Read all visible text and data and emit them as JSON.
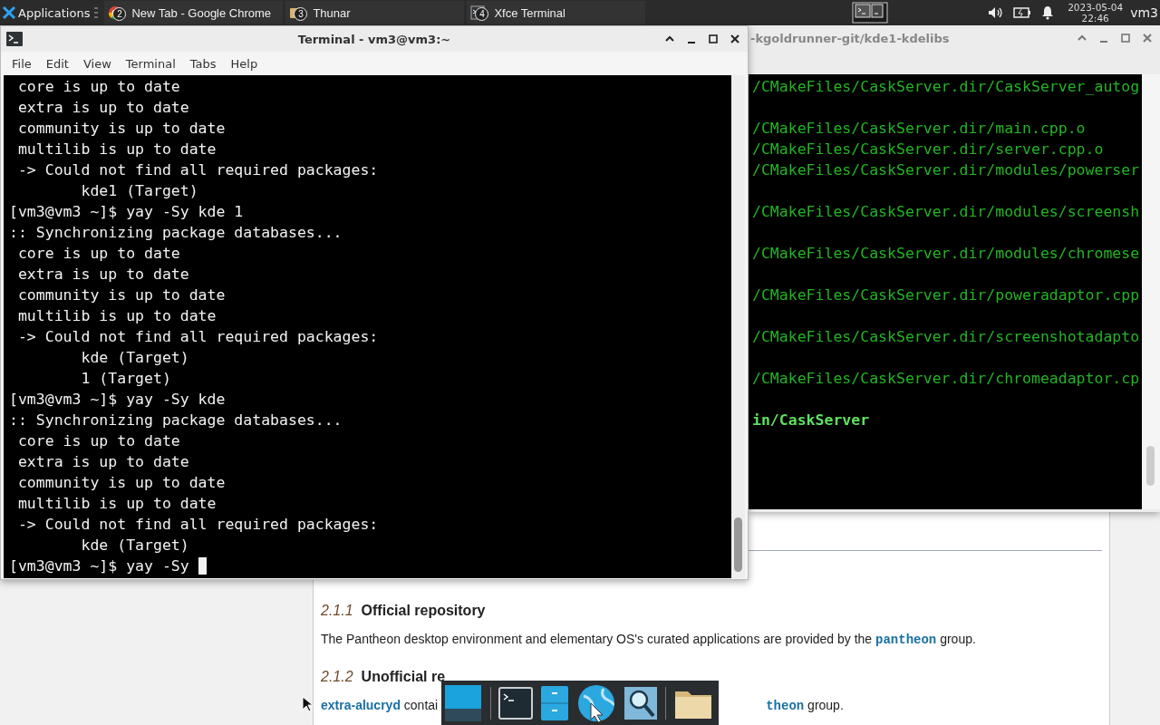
{
  "panel": {
    "apps_menu": "Applications",
    "tasks": [
      {
        "label": "New Tab - Google Chrome",
        "badge": "2",
        "kind": "browser"
      },
      {
        "label": "Thunar",
        "badge": "3",
        "kind": "files"
      },
      {
        "label": "Xfce Terminal",
        "badge": "4",
        "kind": "terminal"
      }
    ],
    "clock": {
      "date": "2023-05-04",
      "time": "22:46"
    },
    "user": "vm3"
  },
  "back_window": {
    "title": "-kgoldrunner-git/kde1-kdelibs",
    "lines": [
      {
        "text": "/CMakeFiles/CaskServer.dir/CaskServer_autog",
        "gap_before": false,
        "bold": false
      },
      {
        "text": "/CMakeFiles/CaskServer.dir/main.cpp.o",
        "gap_before": true,
        "bold": false
      },
      {
        "text": "/CMakeFiles/CaskServer.dir/server.cpp.o",
        "gap_before": false,
        "bold": false
      },
      {
        "text": "/CMakeFiles/CaskServer.dir/modules/powerser",
        "gap_before": false,
        "bold": false
      },
      {
        "text": "/CMakeFiles/CaskServer.dir/modules/screensh",
        "gap_before": true,
        "bold": false
      },
      {
        "text": "/CMakeFiles/CaskServer.dir/modules/chromese",
        "gap_before": true,
        "bold": false
      },
      {
        "text": "/CMakeFiles/CaskServer.dir/poweradaptor.cpp",
        "gap_before": true,
        "bold": false
      },
      {
        "text": "/CMakeFiles/CaskServer.dir/screenshotadapto",
        "gap_before": true,
        "bold": false
      },
      {
        "text": "/CMakeFiles/CaskServer.dir/chromeadaptor.cp",
        "gap_before": true,
        "bold": false
      },
      {
        "text": "in/CaskServer",
        "gap_before": true,
        "bold": true
      }
    ]
  },
  "terminal": {
    "title": "Terminal - vm3@vm3:~",
    "menu": [
      "File",
      "Edit",
      "View",
      "Terminal",
      "Tabs",
      "Help"
    ],
    "cursor": true,
    "lines": [
      " core is up to date",
      " extra is up to date",
      " community is up to date",
      " multilib is up to date",
      " -> Could not find all required packages:",
      "        kde1 (Target)",
      "[vm3@vm3 ~]$ yay -Sy kde 1",
      ":: Synchronizing package databases...",
      " core is up to date",
      " extra is up to date",
      " community is up to date",
      " multilib is up to date",
      " -> Could not find all required packages:",
      "        kde (Target)",
      "        1 (Target)",
      "[vm3@vm3 ~]$ yay -Sy kde",
      ":: Synchronizing package databases...",
      " core is up to date",
      " extra is up to date",
      " community is up to date",
      " multilib is up to date",
      " -> Could not find all required packages:",
      "        kde (Target)",
      "[vm3@vm3 ~]$ yay -Sy"
    ]
  },
  "page": {
    "sections": [
      {
        "number": "2.1.1",
        "title": "Official repository",
        "parts": [
          {
            "kind": "text",
            "text": "The Pantheon desktop environment and elementary OS's curated applications are provided by the "
          },
          {
            "kind": "code",
            "text": "pantheon"
          },
          {
            "kind": "text",
            "text": " group."
          }
        ]
      },
      {
        "number": "2.1.2",
        "title": "Unofficial re",
        "parts": [
          {
            "kind": "link",
            "text": "extra-alucryd"
          },
          {
            "kind": "text",
            "text": " contai"
          },
          {
            "kind": "covered"
          },
          {
            "kind": "code",
            "text": "theon"
          },
          {
            "kind": "text",
            "text": " group."
          }
        ]
      }
    ]
  }
}
